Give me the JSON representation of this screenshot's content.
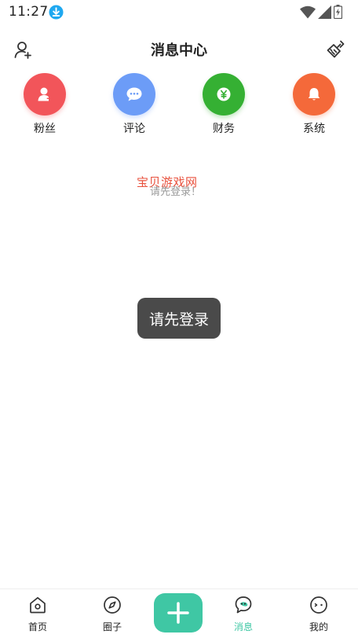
{
  "status_bar": {
    "time": "11:27",
    "download_icon": "download-icon",
    "wifi_icon": "wifi-icon",
    "signal_icon": "signal-icon",
    "battery_icon": "battery-charging-icon"
  },
  "header": {
    "title": "消息中心",
    "left_icon": "add-user-icon",
    "right_icon": "clear-broom-icon"
  },
  "categories": [
    {
      "label": "粉丝",
      "icon": "fan-user-icon",
      "color": "#f2555a"
    },
    {
      "label": "评论",
      "icon": "comment-bubble-icon",
      "color": "#6c9cf7"
    },
    {
      "label": "财务",
      "icon": "yen-coin-icon",
      "color": "#35b033"
    },
    {
      "label": "系统",
      "icon": "bell-icon",
      "color": "#f4693a"
    }
  ],
  "watermark": "宝贝游戏网",
  "empty_message": "请先登录！",
  "toast": "请先登录",
  "tabbar": {
    "items": [
      {
        "label": "首页",
        "icon": "home-icon",
        "active": false
      },
      {
        "label": "圈子",
        "icon": "compass-icon",
        "active": false
      },
      {
        "label": "消息",
        "icon": "message-chat-icon",
        "active": true
      },
      {
        "label": "我的",
        "icon": "profile-face-icon",
        "active": false
      }
    ],
    "fab_icon": "plus-icon"
  },
  "colors": {
    "accent": "#3fc7a4",
    "toast_bg": "#4a4a4a"
  }
}
